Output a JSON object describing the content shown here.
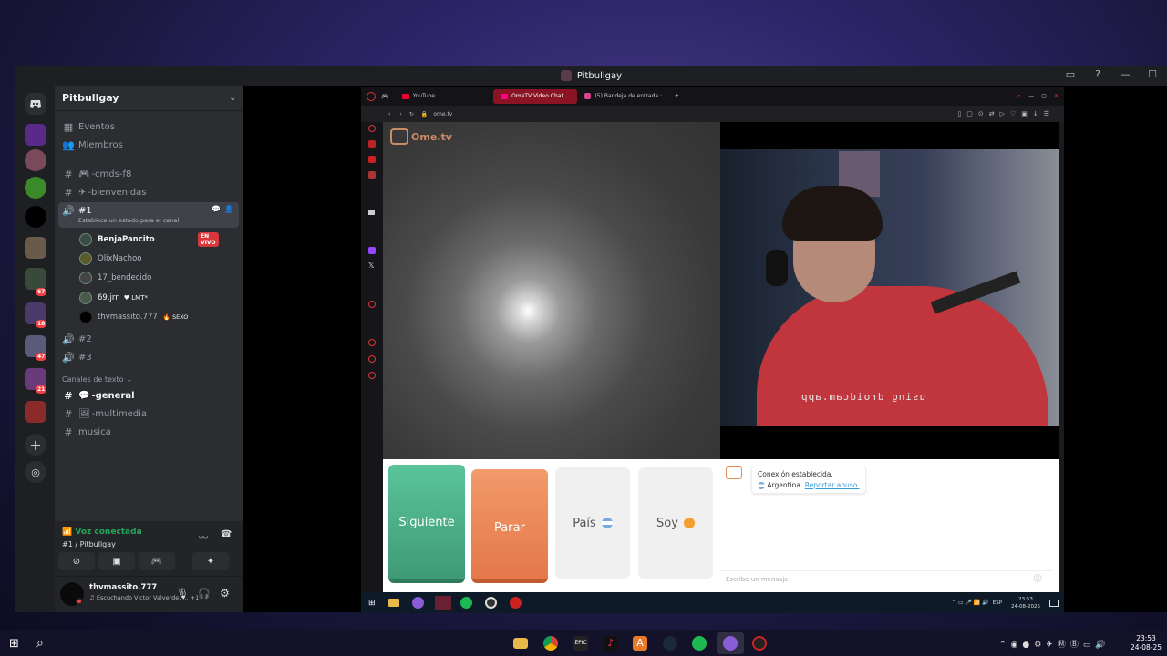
{
  "window": {
    "title": "Pitbullgay"
  },
  "discord": {
    "server_name": "Pitbullgay",
    "guild_badges": [
      "67",
      "18",
      "47",
      "21"
    ],
    "nav": [
      {
        "icon": "calendar-icon",
        "label": "Eventos"
      },
      {
        "icon": "members-icon",
        "label": "Miembros"
      }
    ],
    "channels_top": [
      "-cmds-f8",
      "-bienvenidas"
    ],
    "active_voice": {
      "name": "#1",
      "status_hint": "Establece un estado para el canal"
    },
    "voice_users": [
      {
        "name": "BenjaPancito",
        "badge": "EN VIVO"
      },
      {
        "name": "OlixNachoo",
        "badge": ""
      },
      {
        "name": "17_bendecido",
        "badge": ""
      },
      {
        "name": "69.jrr",
        "badge": "LMT"
      },
      {
        "name": "thvmassito.777",
        "badge": "SEXO"
      }
    ],
    "voice_channels": [
      "#2",
      "#3"
    ],
    "text_category": "Canales de texto",
    "text_channels": [
      "-general",
      "-multimedia",
      "musica"
    ],
    "voice_status": "Voz conectada",
    "voice_location": "#1 / Pitbullgay",
    "user": {
      "name": "thvmassito.777",
      "activity": "Escuchando Victor Valverde, ...",
      "extra": "+1"
    }
  },
  "browser": {
    "tabs": [
      {
        "label": "YouTube"
      },
      {
        "label": "OmeTV Video Chat ..."
      },
      {
        "label": "(5) Bandeja de entrada ·"
      }
    ],
    "url": "ome.tv"
  },
  "ometv": {
    "logo": "Ome.tv",
    "cam_overlay": "using droidcam.app",
    "buttons": {
      "next": "Siguiente",
      "stop": "Parar",
      "country": "País",
      "me": "Soy"
    },
    "chat": {
      "message1": "Conexión establecida.",
      "country": "Argentina.",
      "report": "Reportar abuso.",
      "placeholder": "Escribe un mensaje"
    }
  },
  "inner_taskbar": {
    "lang": "ESP",
    "time": "23:53",
    "date": "24-08-2025"
  },
  "taskbar": {
    "time": "23:53",
    "date": "24-08-25"
  }
}
